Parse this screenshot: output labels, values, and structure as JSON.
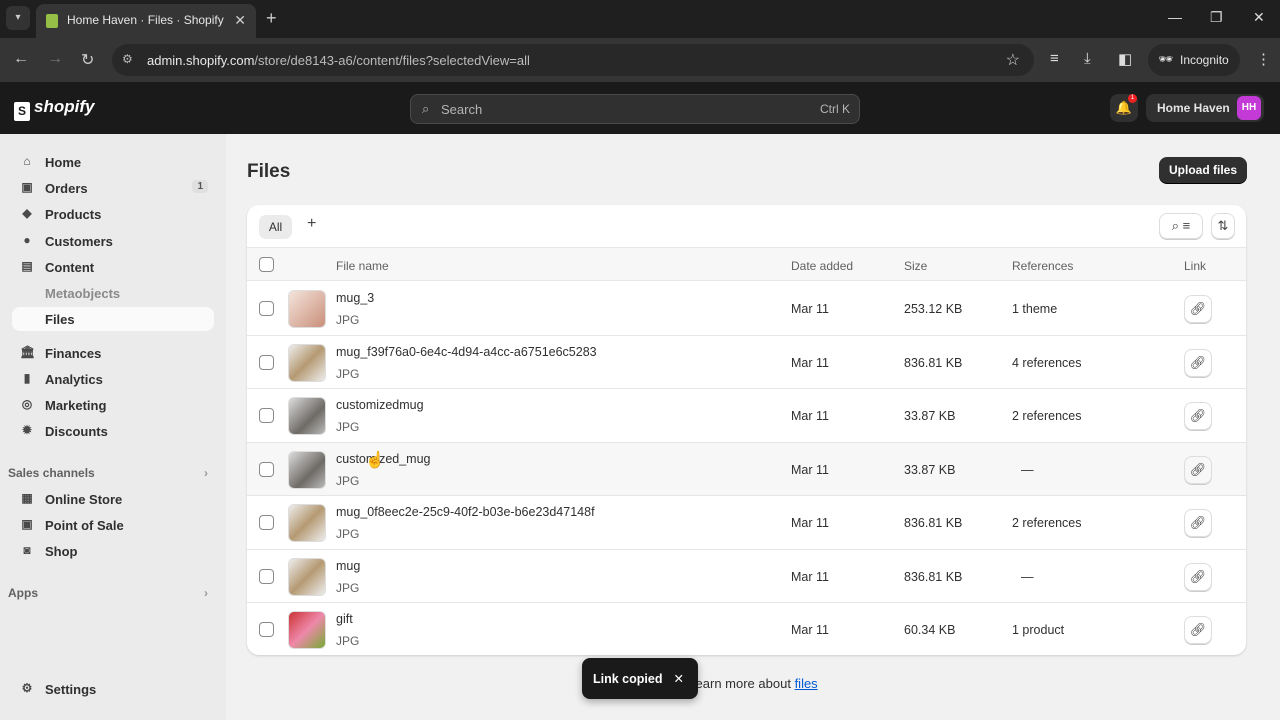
{
  "browser": {
    "tab_title": "Home Haven · Files · Shopify",
    "url_host": "admin.shopify.com",
    "url_path": "/store/de8143-a6/content/files?selectedView=all",
    "incognito_label": "Incognito"
  },
  "topbar": {
    "logo": "shopify",
    "search_placeholder": "Search",
    "search_shortcut": "Ctrl K",
    "notification_count": "1",
    "store_name": "Home Haven",
    "avatar_initials": "HH",
    "avatar_color": "#c43ad6"
  },
  "sidebar": {
    "items": [
      {
        "label": "Home",
        "icon": "home-icon"
      },
      {
        "label": "Orders",
        "icon": "inbox-icon",
        "badge": "1"
      },
      {
        "label": "Products",
        "icon": "tag-icon"
      },
      {
        "label": "Customers",
        "icon": "person-icon"
      },
      {
        "label": "Content",
        "icon": "image-icon"
      },
      {
        "label": "Metaobjects"
      },
      {
        "label": "Files",
        "selected": true
      },
      {
        "label": "Finances",
        "icon": "bank-icon"
      },
      {
        "label": "Analytics",
        "icon": "bar-chart-icon"
      },
      {
        "label": "Marketing",
        "icon": "target-icon"
      },
      {
        "label": "Discounts",
        "icon": "discount-icon"
      }
    ],
    "sales_channels_label": "Sales channels",
    "channels": [
      {
        "label": "Online Store"
      },
      {
        "label": "Point of Sale"
      },
      {
        "label": "Shop"
      }
    ],
    "apps_label": "Apps",
    "settings_label": "Settings"
  },
  "page": {
    "title": "Files",
    "upload_label": "Upload files",
    "filter_tab": "All",
    "columns": {
      "name": "File name",
      "date": "Date added",
      "size": "Size",
      "refs": "References",
      "link": "Link"
    },
    "files": [
      {
        "name": "mug_3",
        "type": "JPG",
        "date": "Mar 11",
        "size": "253.12 KB",
        "refs": "1 theme"
      },
      {
        "name": "mug_f39f76a0-6e4c-4d94-a4cc-a6751e6c5283",
        "type": "JPG",
        "date": "Mar 11",
        "size": "836.81 KB",
        "refs": "4 references"
      },
      {
        "name": "customizedmug",
        "type": "JPG",
        "date": "Mar 11",
        "size": "33.87 KB",
        "refs": "2 references"
      },
      {
        "name": "customized_mug",
        "type": "JPG",
        "date": "Mar 11",
        "size": "33.87 KB",
        "refs": "—"
      },
      {
        "name": "mug_0f8eec2e-25c9-40f2-b03e-b6e23d47148f",
        "type": "JPG",
        "date": "Mar 11",
        "size": "836.81 KB",
        "refs": "2 references"
      },
      {
        "name": "mug",
        "type": "JPG",
        "date": "Mar 11",
        "size": "836.81 KB",
        "refs": "—"
      },
      {
        "name": "gift",
        "type": "JPG",
        "date": "Mar 11",
        "size": "60.34 KB",
        "refs": "1 product"
      }
    ],
    "learn_text": "Learn more about",
    "learn_link": "files"
  },
  "toast": {
    "message": "Link copied"
  }
}
